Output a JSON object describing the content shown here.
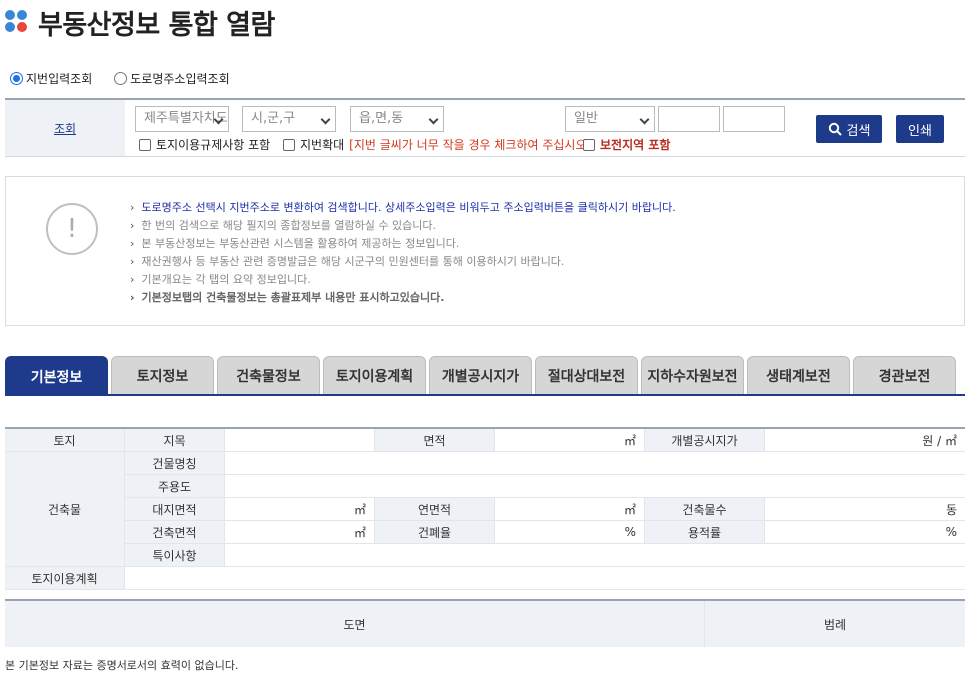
{
  "title": "부동산정보 통합 열람",
  "radios": [
    {
      "label": "지번입력조회",
      "checked": true
    },
    {
      "label": "도로명주소입력조회",
      "checked": false
    }
  ],
  "search": {
    "label": "조회",
    "sido": "제주특별자치도",
    "sigungu": "시,군,구",
    "eupmyeondong": "읍,면,동",
    "type": "일반",
    "check_landuse": "토지이용규제사항 포함",
    "check_enlarge": "지번확대",
    "enlarge_hint": "[지번 글씨가 너무 작을 경우 체크하여 주십시오]",
    "check_preserve": "보전지역 포함",
    "search_btn": "검색",
    "print_btn": "인쇄"
  },
  "info": {
    "icon": "!",
    "lines": [
      "도로명주소 선택시 지번주소로 변환하여 검색합니다. 상세주소입력은 비워두고 주소입력버튼을 클릭하시기 바랍니다.",
      "한 번의 검색으로 해당 필지의 종합정보를 열람하실 수 있습니다.",
      "본 부동산정보는 부동산관련 시스템을 활용하여 제공하는 정보입니다.",
      "재산권행사 등 부동산 관련 증명발급은 해당 시군구의 민원센터를 통해 이용하시기 바랍니다.",
      "기본개요는 각 탭의 요약 정보입니다.",
      "기본정보탭의 건축물정보는 총괄표제부 내용만 표시하고있습니다."
    ]
  },
  "tabs": [
    "기본정보",
    "토지정보",
    "건축물정보",
    "토지이용계획",
    "개별공시지가",
    "절대상대보전",
    "지하수자원보전",
    "생태계보전",
    "경관보전"
  ],
  "table": {
    "land": "토지",
    "jimok": "지목",
    "area": "면적",
    "area_unit": "㎡",
    "price": "개별공시지가",
    "price_unit": "원 / ㎡",
    "building": "건축물",
    "bldg_name": "건물명칭",
    "main_use": "주용도",
    "site_area": "대지면적",
    "site_area_unit": "㎡",
    "total_area": "연면적",
    "total_area_unit": "㎡",
    "bldg_count": "건축물수",
    "bldg_count_unit": "동",
    "bldg_area": "건축면적",
    "bldg_area_unit": "㎡",
    "coverage": "건폐율",
    "coverage_unit": "%",
    "far": "용적률",
    "far_unit": "%",
    "special": "특이사항",
    "land_use_plan": "토지이용계획"
  },
  "map": {
    "drawing": "도면",
    "legend": "범례"
  },
  "footer": "본 기본정보 자료는 증명서로서의 효력이 없습니다."
}
